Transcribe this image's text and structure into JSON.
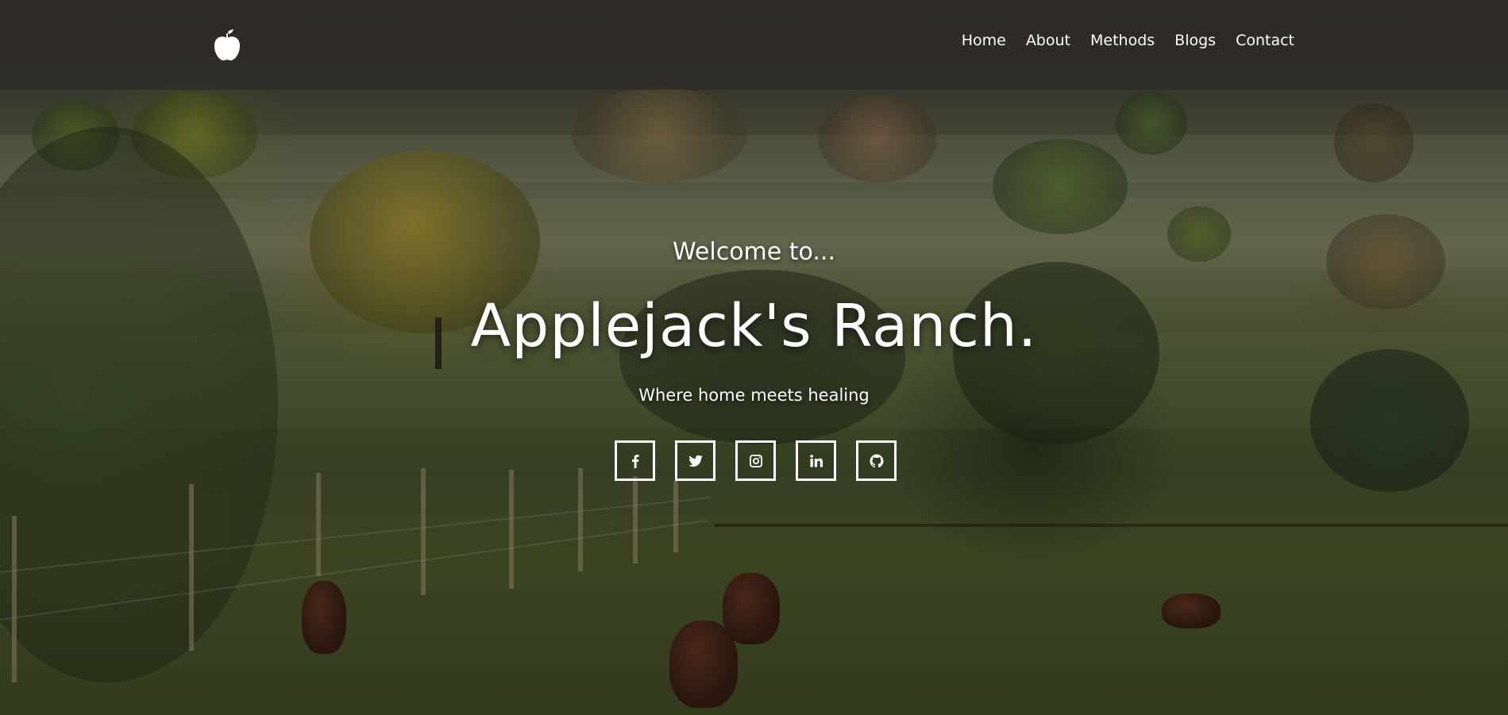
{
  "navbar": {
    "logo_icon": "apple-icon",
    "links": [
      {
        "label": "Home"
      },
      {
        "label": "About"
      },
      {
        "label": "Methods"
      },
      {
        "label": "Blogs"
      },
      {
        "label": "Contact"
      }
    ]
  },
  "hero": {
    "welcome": "Welcome to...",
    "title": "Applejack's Ranch.",
    "tagline": "Where home meets healing",
    "social_icons": [
      "facebook-icon",
      "twitter-icon",
      "instagram-icon",
      "linkedin-icon",
      "github-icon"
    ]
  },
  "colors": {
    "text": "#ffffff",
    "navbar_bg": "#2d2a28"
  }
}
